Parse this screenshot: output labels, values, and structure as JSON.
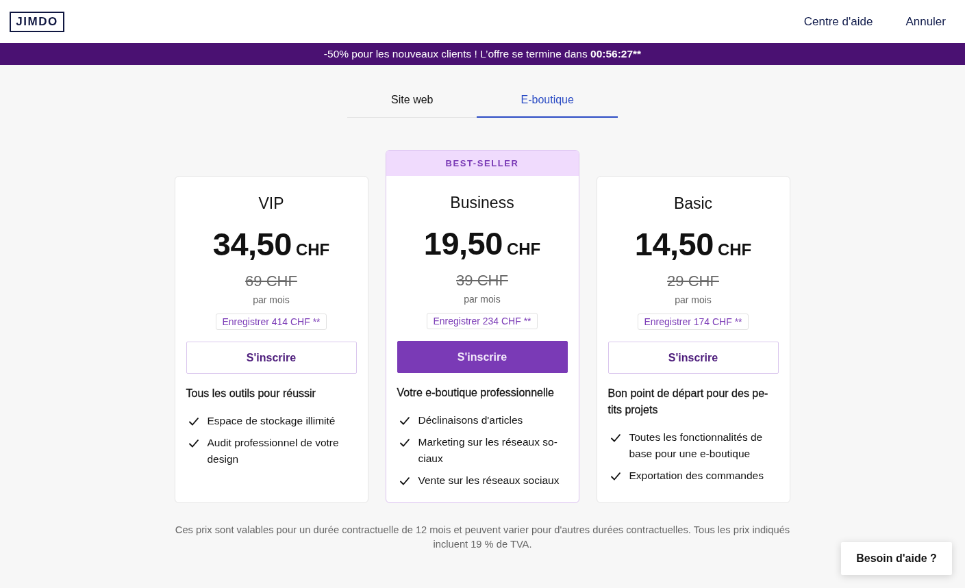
{
  "header": {
    "logo": "JIMDO",
    "links": [
      "Centre d'aide",
      "Annuler"
    ]
  },
  "promo": {
    "text": "-50% pour les nouveaux clients ! L’offre se termine dans",
    "countdown": "00:56:27**"
  },
  "tabs": [
    {
      "label": "Site web",
      "selected": false
    },
    {
      "label": "E-boutique",
      "selected": true
    }
  ],
  "plans": [
    {
      "name": "VIP",
      "price": "34,50",
      "currency": "CHF",
      "old_price": "69 CHF",
      "period": "par mois",
      "savings": "Enregistrer 414 CHF **",
      "button": "S'inscrire",
      "highlighted": false,
      "description": "Tous les outils pour réussir",
      "features": [
        "Espace de stockage illimité",
        "Audit professionnel de votre design"
      ]
    },
    {
      "badge": "BEST-SELLER",
      "name": "Business",
      "price": "19,50",
      "currency": "CHF",
      "old_price": "39 CHF",
      "period": "par mois",
      "savings": "Enregistrer 234 CHF **",
      "button": "S'inscrire",
      "highlighted": true,
      "description": "Votre e-boutique professionnelle",
      "features": [
        "Déclinaisons d'articles",
        "Marketing sur les réseaux so-ciaux",
        "Vente sur les réseaux sociaux"
      ]
    },
    {
      "name": "Basic",
      "price": "14,50",
      "currency": "CHF",
      "old_price": "29 CHF",
      "period": "par mois",
      "savings": "Enregistrer 174 CHF **",
      "button": "S'inscrire",
      "highlighted": false,
      "description": "Bon point de départ pour des pe-tits projets",
      "features": [
        "Toutes les fonctionnalités de base pour une e-boutique",
        "Exportation des commandes"
      ]
    }
  ],
  "footnote": "Ces prix sont valables pour un durée contractuelle de 12 mois et peuvent varier pour d'autres durées contractuelles. Tous les prix indiqués incluent 19 % de TVA.",
  "help_button": "Besoin d'aide ?"
}
